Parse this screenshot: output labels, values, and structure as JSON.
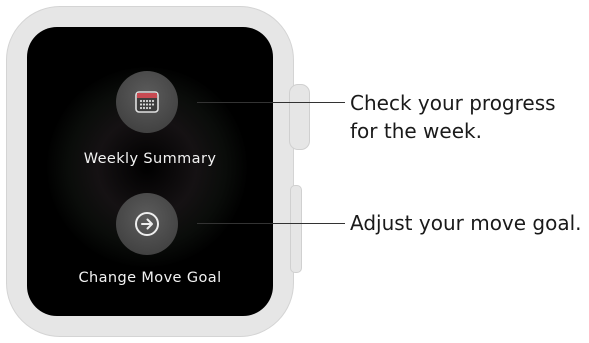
{
  "actions": [
    {
      "label": "Weekly Summary",
      "icon": "calendar-icon",
      "callout": [
        "Check your progress",
        "for the week."
      ]
    },
    {
      "label": "Change Move Goal",
      "icon": "arrow-circle-icon",
      "callout": [
        "Adjust your move goal."
      ]
    }
  ],
  "colors": {
    "screen": "#000000",
    "case": "#e6e6e6",
    "button_fill": "#4a4a4a",
    "label_text": "#f2f2f2",
    "callout_text": "#1a1a1a",
    "calendar_header": "#c74a52",
    "calendar_dots": "#d8d8d8"
  }
}
